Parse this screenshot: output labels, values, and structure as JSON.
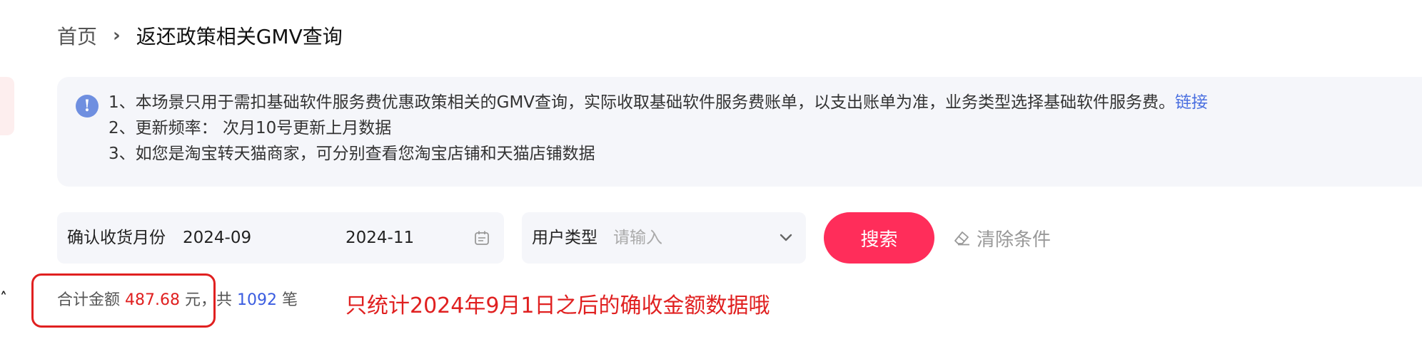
{
  "breadcrumb": {
    "home": "首页",
    "separator": "›",
    "current": "返还政策相关GMV查询"
  },
  "notice": {
    "icon": "info-icon",
    "icon_glyph": "!",
    "line1": "1、本场景只用于需扣基础软件服务费优惠政策相关的GMV查询，实际收取基础软件服务费账单，以支出账单为准，业务类型选择基础软件服务费。",
    "link_label": "链接",
    "line2": "2、更新频率： 次月10号更新上月数据",
    "line3": "3、如您是淘宝转天猫商家，可分别查看您淘宝店铺和天猫店铺数据"
  },
  "filters": {
    "date_label": "确认收货月份",
    "date_start": "2024-09",
    "date_end": "2024-11",
    "date_icon": "calendar-icon",
    "user_type_label": "用户类型",
    "user_type_placeholder": "请输入",
    "user_type_icon": "chevron-down-icon",
    "search_label": "搜索",
    "clear_label": "清除条件",
    "clear_icon": "eraser-icon"
  },
  "summary": {
    "collapse_glyph": "˄",
    "prefix": "合计金额",
    "amount": "487.68",
    "unit": "元",
    "count_prefix": "，共",
    "count": "1092",
    "count_unit": "笔"
  },
  "annotation": "只统计2024年9月1日之后的确收金额数据哦",
  "colors": {
    "brand": "#ff2d5a",
    "amount": "#e02020",
    "count": "#3a5ce0",
    "link": "#4a6fe0",
    "notice_bg": "#f5f6fa",
    "info_icon": "#6f8fe0"
  }
}
